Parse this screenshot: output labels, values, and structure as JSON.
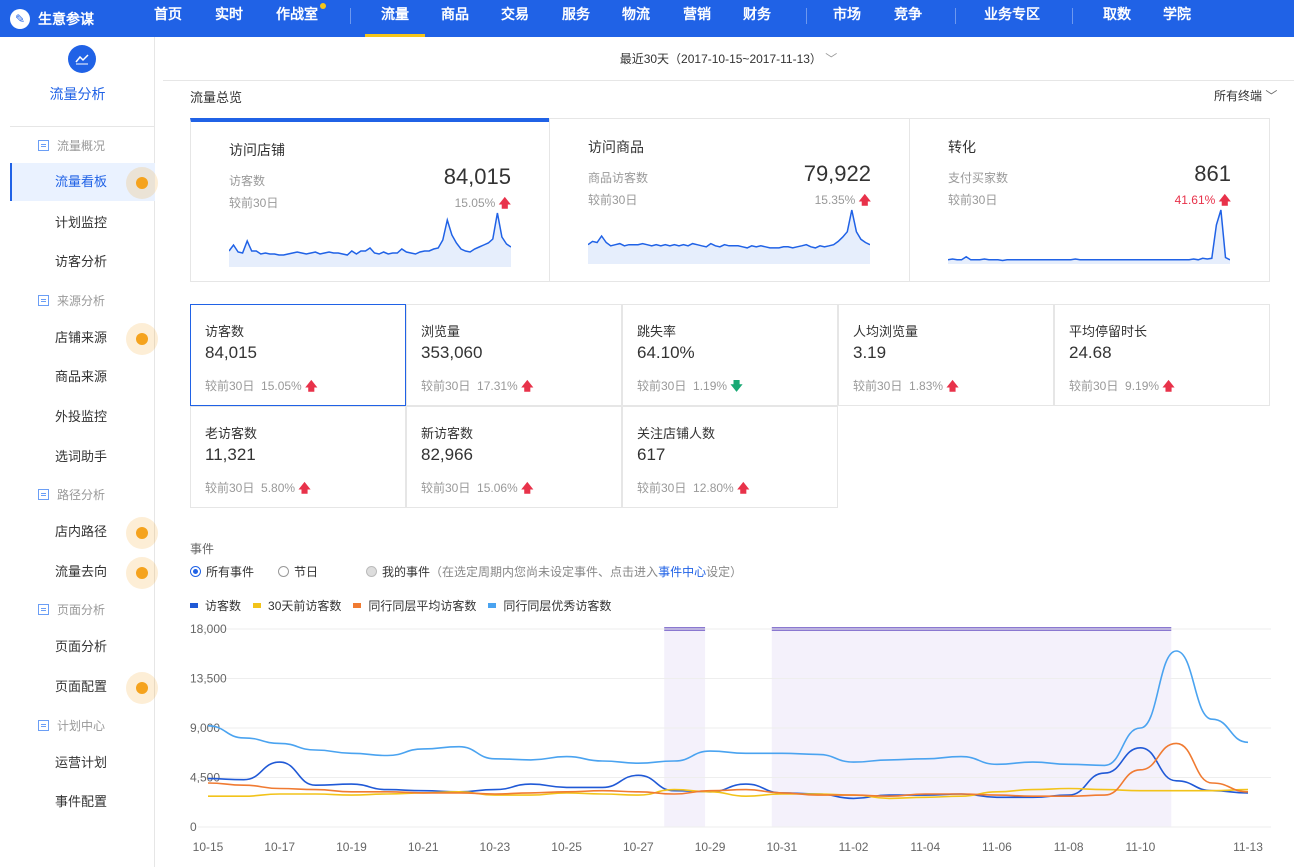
{
  "topnav": {
    "brand": "生意参谋",
    "items": [
      {
        "label": "首页"
      },
      {
        "label": "实时"
      },
      {
        "label": "作战室"
      },
      {
        "label": "流量"
      },
      {
        "label": "商品"
      },
      {
        "label": "交易"
      },
      {
        "label": "服务"
      },
      {
        "label": "物流"
      },
      {
        "label": "营销"
      },
      {
        "label": "财务"
      },
      {
        "label": "市场"
      },
      {
        "label": "竞争"
      },
      {
        "label": "业务专区"
      },
      {
        "label": "取数"
      },
      {
        "label": "学院"
      }
    ],
    "active": "流量",
    "accent": "#2062e6"
  },
  "sidebar": {
    "title": "流量分析",
    "sections": [
      {
        "label": "流量概况",
        "items": [
          "流量看板",
          "计划监控",
          "访客分析"
        ]
      },
      {
        "label": "来源分析",
        "items": [
          "店铺来源",
          "商品来源",
          "外投监控",
          "选词助手"
        ]
      },
      {
        "label": "路径分析",
        "items": [
          "店内路径",
          "流量去向"
        ]
      },
      {
        "label": "页面分析",
        "items": [
          "页面分析",
          "页面配置"
        ]
      },
      {
        "label": "计划中心",
        "items": [
          "运营计划",
          "事件配置"
        ]
      }
    ],
    "active_item": "流量看板"
  },
  "date_range": "最近30天（2017-10-15~2017-11-13）",
  "section_title": "流量总览",
  "terminal_select": "所有终端",
  "cards": [
    {
      "title": "访问店铺",
      "label": "访客数",
      "value": "84,015",
      "comp_label": "较前30日",
      "comp_value": "15.05%",
      "trend": [
        14,
        20,
        13,
        12,
        24,
        14,
        14,
        11,
        12,
        11,
        11,
        10,
        10,
        11,
        12,
        13,
        12,
        11,
        12,
        13,
        11,
        12,
        13,
        12,
        12,
        11,
        10,
        14,
        11,
        14,
        14,
        17,
        12,
        11,
        13,
        11,
        12,
        12,
        16,
        13,
        12,
        11,
        13,
        14,
        14,
        16,
        17,
        25,
        45,
        30,
        22,
        16,
        14,
        13,
        16,
        18,
        20,
        22,
        26,
        52,
        28,
        21,
        18
      ]
    },
    {
      "title": "访问商品",
      "label": "商品访客数",
      "value": "79,922",
      "comp_label": "较前30日",
      "comp_value": "15.35%",
      "trend": [
        16,
        19,
        18,
        24,
        18,
        15,
        16,
        17,
        15,
        16,
        16,
        16,
        17,
        16,
        15,
        16,
        15,
        16,
        15,
        16,
        15,
        16,
        15,
        17,
        16,
        15,
        14,
        17,
        15,
        14,
        16,
        15,
        15,
        15,
        14,
        13,
        15,
        14,
        15,
        14,
        13,
        13,
        13,
        14,
        14,
        13,
        14,
        15,
        16,
        14,
        13,
        15,
        14,
        15,
        16,
        19,
        23,
        28,
        48,
        28,
        21,
        18,
        16
      ]
    },
    {
      "title": "转化",
      "label": "支付买家数",
      "value": "861",
      "comp_label": "较前30日",
      "comp_value": "41.61%",
      "trend": [
        3,
        4,
        3,
        3,
        7,
        3,
        3,
        3,
        4,
        3,
        3,
        3,
        2,
        3,
        3,
        3,
        3,
        3,
        3,
        3,
        3,
        3,
        3,
        3,
        3,
        3,
        3,
        3,
        4,
        3,
        3,
        3,
        3,
        3,
        3,
        3,
        3,
        3,
        3,
        3,
        3,
        3,
        3,
        3,
        3,
        3,
        3,
        3,
        3,
        3,
        3,
        3,
        3,
        3,
        4,
        3,
        5,
        4,
        5,
        50,
        70,
        6,
        3
      ]
    }
  ],
  "metrics": [
    {
      "name": "访客数",
      "value": "84,015",
      "comp_label": "较前30日",
      "comp_value": "15.05%",
      "dir": "up"
    },
    {
      "name": "浏览量",
      "value": "353,060",
      "comp_label": "较前30日",
      "comp_value": "17.31%",
      "dir": "up"
    },
    {
      "name": "跳失率",
      "value": "64.10%",
      "comp_label": "较前30日",
      "comp_value": "1.19%",
      "dir": "down"
    },
    {
      "name": "人均浏览量",
      "value": "3.19",
      "comp_label": "较前30日",
      "comp_value": "1.83%",
      "dir": "up"
    },
    {
      "name": "平均停留时长",
      "value": "24.68",
      "comp_label": "较前30日",
      "comp_value": "9.19%",
      "dir": "up"
    },
    {
      "name": "老访客数",
      "value": "11,321",
      "comp_label": "较前30日",
      "comp_value": "5.80%",
      "dir": "up"
    },
    {
      "name": "新访客数",
      "value": "82,966",
      "comp_label": "较前30日",
      "comp_value": "15.06%",
      "dir": "up"
    },
    {
      "name": "关注店铺人数",
      "value": "617",
      "comp_label": "较前30日",
      "comp_value": "12.80%",
      "dir": "up"
    }
  ],
  "events": {
    "title": "事件",
    "options": [
      {
        "label": "所有事件",
        "state": "on"
      },
      {
        "label": "节日",
        "state": "off"
      },
      {
        "label": "我的事件",
        "state": "disabled"
      }
    ],
    "note_prefix": "（在选定周期内您尚未设定事件、点击进入",
    "note_link": "事件中心",
    "note_suffix": "设定）"
  },
  "chart_data": {
    "type": "line",
    "x": [
      "10-15",
      "10-16",
      "10-17",
      "10-18",
      "10-19",
      "10-20",
      "10-21",
      "10-22",
      "10-23",
      "10-24",
      "10-25",
      "10-26",
      "10-27",
      "10-28",
      "10-29",
      "10-30",
      "10-31",
      "11-01",
      "11-02",
      "11-03",
      "11-04",
      "11-05",
      "11-06",
      "11-07",
      "11-08",
      "11-09",
      "11-10",
      "11-11",
      "11-12",
      "11-13"
    ],
    "x_tick_labels": [
      "10-15",
      "10-17",
      "10-19",
      "10-21",
      "10-23",
      "10-25",
      "10-27",
      "10-29",
      "10-31",
      "11-02",
      "11-04",
      "11-06",
      "11-08",
      "11-10",
      "11-13"
    ],
    "y_ticks": [
      "18,000",
      "13,500",
      "9,000",
      "4,500",
      "0"
    ],
    "ylim": [
      0,
      18000
    ],
    "series": [
      {
        "name": "访客数",
        "color": "#2059d6",
        "values": [
          4400,
          4300,
          5900,
          3800,
          3900,
          3400,
          3300,
          3200,
          3400,
          3900,
          3600,
          3600,
          4700,
          3300,
          3200,
          3900,
          3100,
          3000,
          2600,
          2900,
          2900,
          3000,
          2700,
          2700,
          2900,
          4900,
          7200,
          4200,
          3300,
          3100
        ]
      },
      {
        "name": "30天前访客数",
        "color": "#f2c31a",
        "values": [
          2800,
          2800,
          3000,
          3000,
          2900,
          3000,
          3100,
          3200,
          2900,
          2900,
          3100,
          3000,
          2900,
          3400,
          3200,
          2800,
          3000,
          3000,
          2900,
          2600,
          2700,
          2800,
          3200,
          3400,
          3500,
          3400,
          3300,
          3300,
          3300,
          3400
        ]
      },
      {
        "name": "同行同层平均访客数",
        "color": "#f07b32",
        "values": [
          4000,
          3800,
          3500,
          3400,
          3200,
          3200,
          3100,
          3100,
          3000,
          3100,
          3200,
          3300,
          3200,
          3000,
          3300,
          3400,
          3100,
          2900,
          2900,
          2800,
          3000,
          3000,
          2900,
          2800,
          2800,
          2900,
          5200,
          7600,
          4000,
          3200
        ]
      },
      {
        "name": "同行同层优秀访客数",
        "color": "#4aa3f0",
        "values": [
          9200,
          8100,
          7600,
          7000,
          6700,
          6500,
          7100,
          7300,
          6200,
          6100,
          6400,
          6000,
          5800,
          6000,
          6900,
          6700,
          6700,
          6600,
          5900,
          6100,
          6200,
          6400,
          5700,
          5900,
          5700,
          5600,
          9000,
          16000,
          9800,
          7700
        ]
      }
    ],
    "event_ranges": [
      [
        "10-28",
        "10-29"
      ],
      [
        "10-31",
        "11-11"
      ]
    ],
    "event_color": "#8a78d0",
    "event_fill": "#f4f1fb",
    "grid": true
  }
}
